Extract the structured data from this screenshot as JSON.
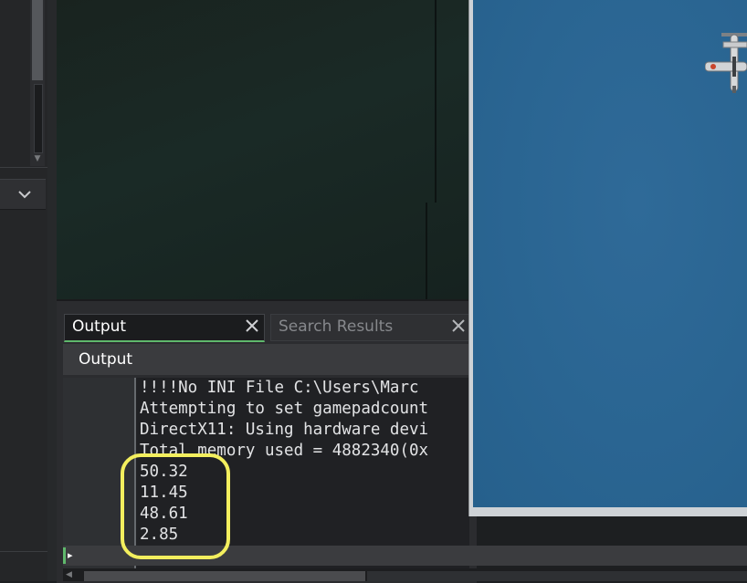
{
  "output_panel": {
    "tabs": [
      {
        "label": "Output",
        "active": true
      },
      {
        "label": "Search Results",
        "active": false
      }
    ],
    "header_title": "Output",
    "console_lines": [
      "!!!!No INI File C:\\Users\\Marc",
      "Attempting to set gamepadcount",
      "DirectX11: Using hardware devi",
      "Total memory used = 4882340(0x",
      "50.32",
      "11.45",
      "48.61",
      "2.85"
    ],
    "highlighted_values": [
      "50.32",
      "11.45",
      "48.61",
      "2.85"
    ]
  },
  "icons": {
    "tab_close": "close-icon",
    "dropdown": "chevron-down-icon",
    "caret": "caret-right-icon",
    "game_sprite": "airplane-icon"
  },
  "colors": {
    "active_tab_accent": "#5fb86c",
    "highlight": "#f3ef5e",
    "game_background": "#2a6592",
    "console_background": "#202124"
  }
}
